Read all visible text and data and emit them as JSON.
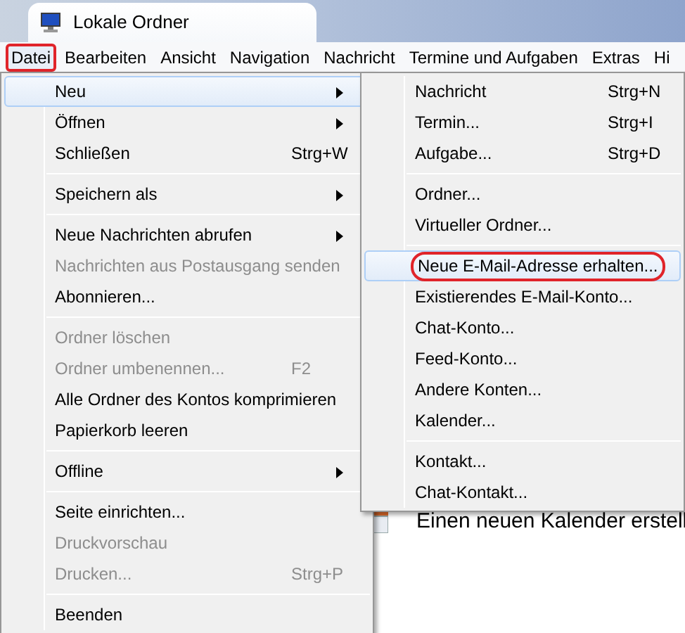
{
  "window": {
    "title": "Lokale Ordner"
  },
  "menubar": [
    {
      "label": "Datei",
      "selected": true,
      "circled": true
    },
    {
      "label": "Bearbeiten",
      "selected": false,
      "circled": false
    },
    {
      "label": "Ansicht",
      "selected": false,
      "circled": false
    },
    {
      "label": "Navigation",
      "selected": false,
      "circled": false
    },
    {
      "label": "Nachricht",
      "selected": false,
      "circled": false
    },
    {
      "label": "Termine und Aufgaben",
      "selected": false,
      "circled": false
    },
    {
      "label": "Extras",
      "selected": false,
      "circled": false
    },
    {
      "label": "Hi",
      "selected": false,
      "circled": false
    }
  ],
  "file_menu": {
    "items": [
      {
        "kind": "item",
        "label": "Neu",
        "submenu": true,
        "disabled": false,
        "selected": true
      },
      {
        "kind": "item",
        "label": "Öffnen",
        "submenu": true,
        "disabled": false,
        "selected": false
      },
      {
        "kind": "item",
        "label": "Schließen",
        "shortcut": "Strg+W",
        "submenu": false,
        "disabled": false,
        "selected": false
      },
      {
        "kind": "separator"
      },
      {
        "kind": "item",
        "label": "Speichern als",
        "submenu": true,
        "disabled": false,
        "selected": false
      },
      {
        "kind": "separator"
      },
      {
        "kind": "item",
        "label": "Neue Nachrichten abrufen",
        "submenu": true,
        "disabled": false,
        "selected": false
      },
      {
        "kind": "item",
        "label": "Nachrichten aus Postausgang senden",
        "submenu": false,
        "disabled": true,
        "selected": false
      },
      {
        "kind": "item",
        "label": "Abonnieren...",
        "submenu": false,
        "disabled": false,
        "selected": false
      },
      {
        "kind": "separator"
      },
      {
        "kind": "item",
        "label": "Ordner löschen",
        "submenu": false,
        "disabled": true,
        "selected": false
      },
      {
        "kind": "item",
        "label": "Ordner umbenennen...",
        "shortcut": "F2",
        "submenu": false,
        "disabled": true,
        "selected": false
      },
      {
        "kind": "item",
        "label": "Alle Ordner des Kontos komprimieren",
        "submenu": false,
        "disabled": false,
        "selected": false
      },
      {
        "kind": "item",
        "label": "Papierkorb leeren",
        "submenu": false,
        "disabled": false,
        "selected": false
      },
      {
        "kind": "separator"
      },
      {
        "kind": "item",
        "label": "Offline",
        "submenu": true,
        "disabled": false,
        "selected": false
      },
      {
        "kind": "separator"
      },
      {
        "kind": "item",
        "label": "Seite einrichten...",
        "submenu": false,
        "disabled": false,
        "selected": false
      },
      {
        "kind": "item",
        "label": "Druckvorschau",
        "submenu": false,
        "disabled": true,
        "selected": false
      },
      {
        "kind": "item",
        "label": "Drucken...",
        "shortcut": "Strg+P",
        "submenu": false,
        "disabled": true,
        "selected": false
      },
      {
        "kind": "separator"
      },
      {
        "kind": "item",
        "label": "Beenden",
        "submenu": false,
        "disabled": false,
        "selected": false
      }
    ]
  },
  "new_submenu": {
    "items": [
      {
        "kind": "item",
        "label": "Nachricht",
        "shortcut": "Strg+N",
        "selected": false,
        "circled": false
      },
      {
        "kind": "item",
        "label": "Termin...",
        "shortcut": "Strg+I",
        "selected": false,
        "circled": false
      },
      {
        "kind": "item",
        "label": "Aufgabe...",
        "shortcut": "Strg+D",
        "selected": false,
        "circled": false
      },
      {
        "kind": "separator"
      },
      {
        "kind": "item",
        "label": "Ordner...",
        "selected": false,
        "circled": false
      },
      {
        "kind": "item",
        "label": "Virtueller Ordner...",
        "selected": false,
        "circled": false
      },
      {
        "kind": "separator"
      },
      {
        "kind": "item",
        "label": "Neue E-Mail-Adresse erhalten...",
        "selected": true,
        "circled": true
      },
      {
        "kind": "item",
        "label": "Existierendes E-Mail-Konto...",
        "selected": false,
        "circled": false
      },
      {
        "kind": "item",
        "label": "Chat-Konto...",
        "selected": false,
        "circled": false
      },
      {
        "kind": "item",
        "label": "Feed-Konto...",
        "selected": false,
        "circled": false
      },
      {
        "kind": "item",
        "label": "Andere Konten...",
        "selected": false,
        "circled": false
      },
      {
        "kind": "item",
        "label": "Kalender...",
        "selected": false,
        "circled": false
      },
      {
        "kind": "separator"
      },
      {
        "kind": "item",
        "label": "Kontakt...",
        "selected": false,
        "circled": false
      },
      {
        "kind": "item",
        "label": "Chat-Kontakt...",
        "selected": false,
        "circled": false
      }
    ]
  },
  "content": {
    "text": "Einen neuen Kalender erstell"
  }
}
